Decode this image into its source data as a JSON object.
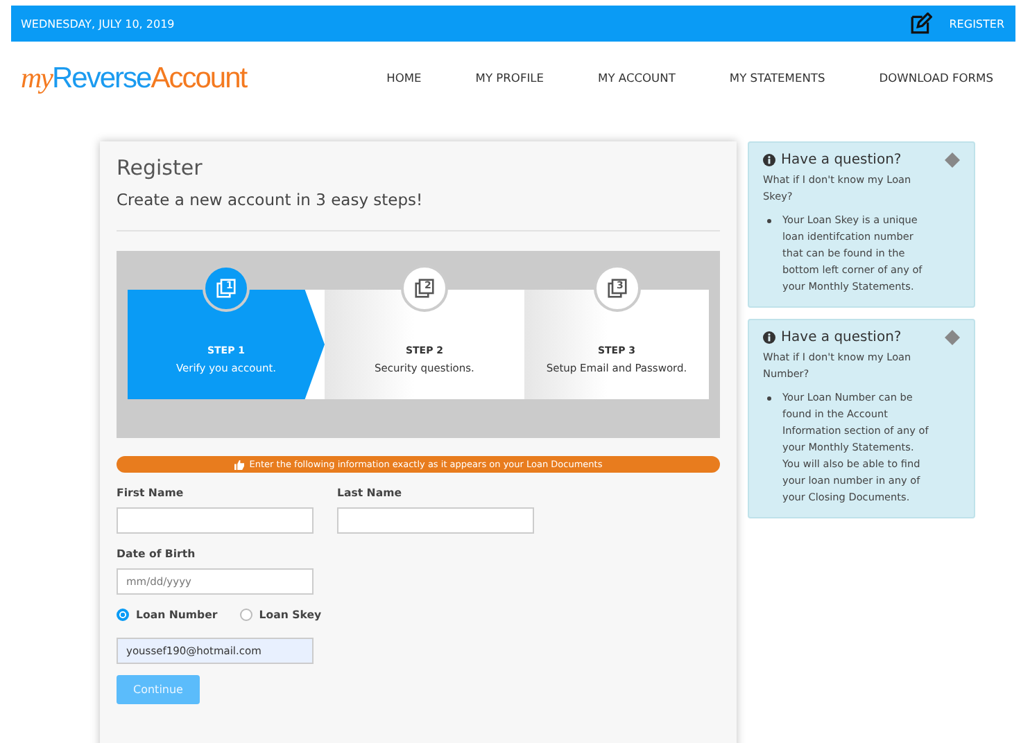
{
  "top_bar": {
    "date": "WEDNESDAY, JULY 10, 2019",
    "register": "REGISTER"
  },
  "logo": [
    {
      "text": "my",
      "color": "#f47a20"
    },
    {
      "text": "Reverse",
      "color": "#1b9bf0"
    },
    {
      "text": "Account",
      "color": "#f47a20"
    }
  ],
  "nav": [
    "HOME",
    "MY PROFILE",
    "MY ACCOUNT",
    "MY STATEMENTS",
    "DOWNLOAD FORMS"
  ],
  "card": {
    "title": "Register",
    "subtitle": "Create a new account in 3 easy steps!",
    "steps": [
      {
        "number": "1",
        "title": "STEP 1",
        "caption": "Verify you account.",
        "selected": true
      },
      {
        "number": "2",
        "title": "STEP 2",
        "caption": "Security questions.",
        "selected": false
      },
      {
        "number": "3",
        "title": "STEP 3",
        "caption": "Setup Email and Password.",
        "selected": false
      }
    ],
    "notice": "Enter the following information exactly as it appears on your Loan Documents",
    "first_name": {
      "label": "First Name"
    },
    "last_name": {
      "label": "Last Name"
    },
    "date_of_birth": {
      "label": "Date of Birth",
      "placeholder": "mm/dd/yyyy"
    },
    "radios": [
      {
        "label": "Loan Number",
        "selected": true
      },
      {
        "label": "Loan Skey",
        "selected": false
      }
    ],
    "loan_field": {
      "value": "youssef190@hotmail.com"
    },
    "button": "Continue"
  },
  "help": [
    {
      "title": "Have a question?",
      "question": "What if I don't know my Loan Skey?",
      "answer": "Your Loan Skey is a unique loan identifcation number that can be found in the bottom left corner of any of your Monthly Statements."
    },
    {
      "title": "Have a question?",
      "question": "What if I don't know my Loan Number?",
      "answer": "Your Loan Number can be found in the Account Information section of any of your Monthly Statements. You will also be able to find your loan number in any of your Closing Documents."
    }
  ]
}
